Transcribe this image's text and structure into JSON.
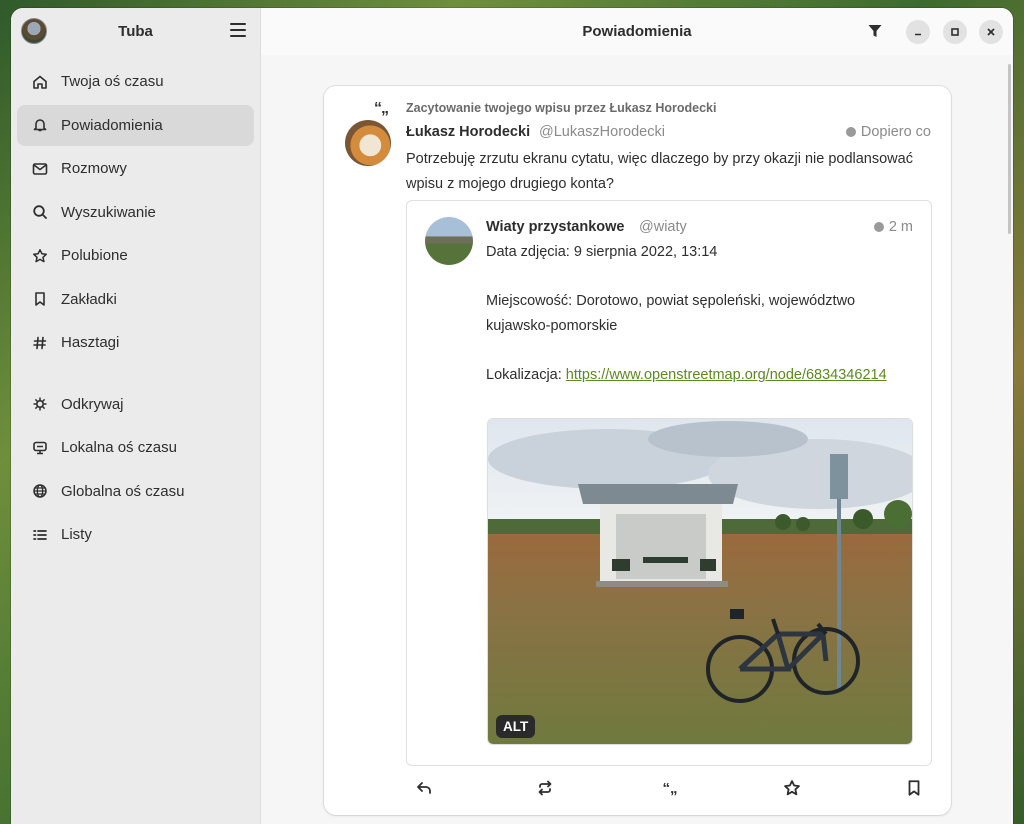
{
  "sidebar": {
    "title": "Tuba",
    "items": [
      {
        "label": "Twoja oś czasu",
        "icon": "home-icon"
      },
      {
        "label": "Powiadomienia",
        "icon": "bell-icon",
        "active": true
      },
      {
        "label": "Rozmowy",
        "icon": "mail-icon"
      },
      {
        "label": "Wyszukiwanie",
        "icon": "search-icon"
      },
      {
        "label": "Polubione",
        "icon": "star-icon"
      },
      {
        "label": "Zakładki",
        "icon": "bookmark-icon"
      },
      {
        "label": "Hasztagi",
        "icon": "hashtag-icon"
      }
    ],
    "items2": [
      {
        "label": "Odkrywaj",
        "icon": "explore-icon"
      },
      {
        "label": "Lokalna oś czasu",
        "icon": "local-timeline-icon"
      },
      {
        "label": "Globalna oś czasu",
        "icon": "globe-icon"
      },
      {
        "label": "Listy",
        "icon": "list-icon"
      }
    ]
  },
  "header": {
    "title": "Powiadomienia"
  },
  "notification": {
    "quote_mark": "“„",
    "kind_text": "Zacytowanie twojego wpisu przez Łukasz Horodecki",
    "author_name": "Łukasz Horodecki",
    "author_handle": "@LukaszHorodecki",
    "time": "Dopiero co",
    "text": "Potrzebuję zrzutu ekranu cytatu, więc dlaczego by przy okazji nie podlansować wpisu z mojego drugiego konta?",
    "quoted": {
      "author_name": "Wiaty przystankowe",
      "author_handle": "@wiaty",
      "time": "2 m",
      "line1": "Data zdjęcia: 9 sierpnia 2022, 13:14",
      "line2": "Miejscowość: Dorotowo, powiat sępoleński, województwo kujawsko-pomorskie",
      "line3_prefix": "Lokalizacja: ",
      "link": "https://www.openstreetmap.org/node/6834346214",
      "alt_badge": "ALT"
    }
  },
  "colors": {
    "accent": "#5c8a1f",
    "sidebar_bg": "#ebebeb",
    "active_bg": "#d9d9d9"
  }
}
